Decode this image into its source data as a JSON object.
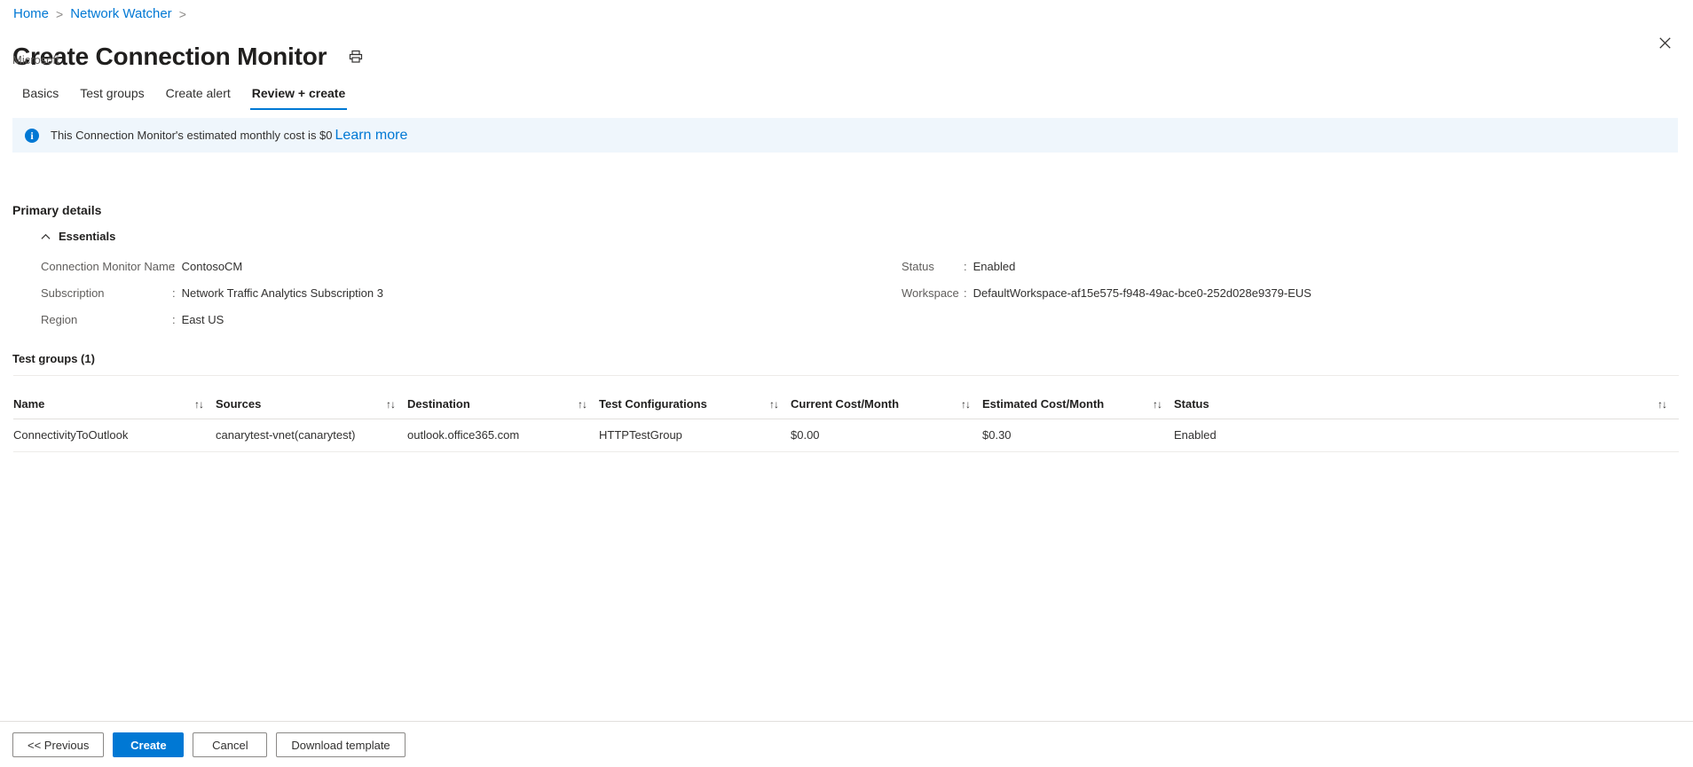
{
  "breadcrumb": {
    "items": [
      "Home",
      "Network Watcher"
    ],
    "separator": ">"
  },
  "header": {
    "title": "Create Connection Monitor",
    "subtitle": "Microsoft",
    "print_icon": "print-icon",
    "close_icon": "close-icon"
  },
  "tabs": [
    {
      "label": "Basics",
      "active": false
    },
    {
      "label": "Test groups",
      "active": false
    },
    {
      "label": "Create alert",
      "active": false
    },
    {
      "label": "Review + create",
      "active": true
    }
  ],
  "info_banner": {
    "icon": "info-icon",
    "text": "This Connection Monitor's estimated monthly cost is $0",
    "link_label": "Learn more",
    "background": "#eff6fc",
    "accent": "#0078d4"
  },
  "primary_details": {
    "section_title": "Primary details",
    "essentials_label": "Essentials",
    "essentials_expanded": true,
    "left_column": [
      {
        "key": "Connection Monitor Name",
        "value": "ContosoCM"
      },
      {
        "key": "Subscription",
        "value": "Network Traffic Analytics Subscription 3"
      },
      {
        "key": "Region",
        "value": "East US"
      }
    ],
    "right_column": [
      {
        "key": "Status",
        "value": "Enabled"
      },
      {
        "key": "Workspace",
        "value": "DefaultWorkspace-af15e575-f948-49ac-bce0-252d028e9379-EUS"
      }
    ],
    "colon": ":"
  },
  "test_groups": {
    "title": "Test groups (1)",
    "sort_icon": "↑↓",
    "columns": [
      "Name",
      "Sources",
      "Destination",
      "Test Configurations",
      "Current Cost/Month",
      "Estimated Cost/Month",
      "Status"
    ],
    "rows": [
      {
        "name": "ConnectivityToOutlook",
        "sources": "canarytest-vnet(canarytest)",
        "destination": "outlook.office365.com",
        "test_configurations": "HTTPTestGroup",
        "current_cost": "$0.00",
        "estimated_cost": "$0.30",
        "status": "Enabled"
      }
    ]
  },
  "footer": {
    "previous_label": "<< Previous",
    "create_label": "Create",
    "cancel_label": "Cancel",
    "download_label": "Download template",
    "primary_color": "#0078d4"
  }
}
